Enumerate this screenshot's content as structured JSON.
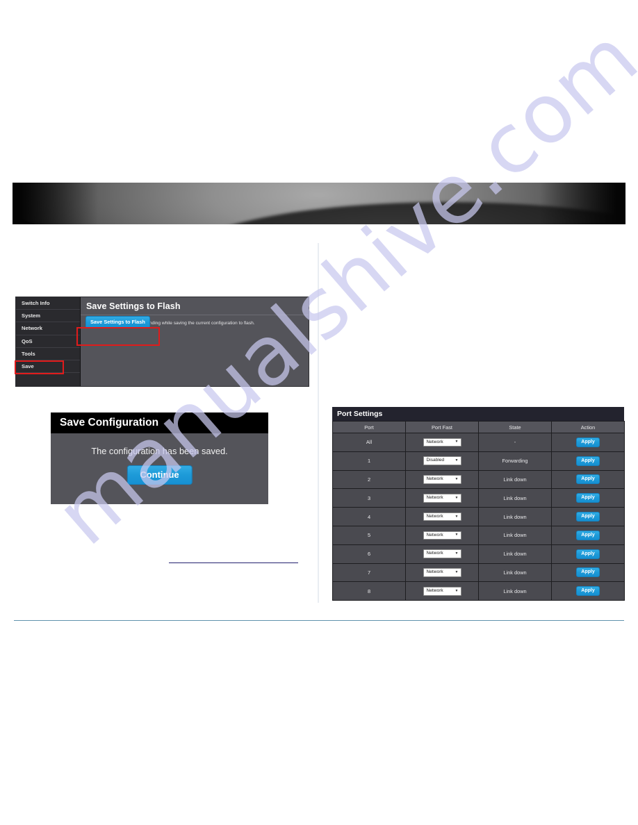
{
  "banner": {
    "name": "decorative-dark-banner"
  },
  "watermark": {
    "text": "manualshive.com"
  },
  "flash_panel": {
    "title": "Save Settings to Flash",
    "note": "Note:The switch will stop responding while saving the current configuration to flash.",
    "save_button": "Save Settings to Flash",
    "sidebar": {
      "items": [
        {
          "label": "Switch Info"
        },
        {
          "label": "System"
        },
        {
          "label": "Network"
        },
        {
          "label": "QoS"
        },
        {
          "label": "Tools"
        },
        {
          "label": "Save"
        }
      ]
    }
  },
  "save_dialog": {
    "title": "Save Configuration",
    "message": "The configuration has been saved.",
    "continue_button": "Continue"
  },
  "port_settings": {
    "title": "Port Settings",
    "columns": [
      "Port",
      "Port Fast",
      "State",
      "Action"
    ],
    "action_label": "Apply",
    "caret": "▼",
    "rows": [
      {
        "port": "All",
        "port_fast": "Network",
        "state": "-",
        "action": "Apply"
      },
      {
        "port": "1",
        "port_fast": "Disabled",
        "state": "Forwarding",
        "action": "Apply"
      },
      {
        "port": "2",
        "port_fast": "Network",
        "state": "Link down",
        "action": "Apply"
      },
      {
        "port": "3",
        "port_fast": "Network",
        "state": "Link down",
        "action": "Apply"
      },
      {
        "port": "4",
        "port_fast": "Network",
        "state": "Link down",
        "action": "Apply"
      },
      {
        "port": "5",
        "port_fast": "Network",
        "state": "Link down",
        "action": "Apply"
      },
      {
        "port": "6",
        "port_fast": "Network",
        "state": "Link down",
        "action": "Apply"
      },
      {
        "port": "7",
        "port_fast": "Network",
        "state": "Link down",
        "action": "Apply"
      },
      {
        "port": "8",
        "port_fast": "Network",
        "state": "Link down",
        "action": "Apply"
      }
    ]
  },
  "colors": {
    "accent_blue": "#1d9ad8",
    "annotation_red": "#e01b1b",
    "rule_navy": "#221f6e",
    "rule_teal": "#5f93ad",
    "panel_gray": "#54545a",
    "sidebar_dark": "#2a2a2e",
    "titlebar_black": "#000000",
    "watermark_lavender": "#c9c9ef"
  }
}
